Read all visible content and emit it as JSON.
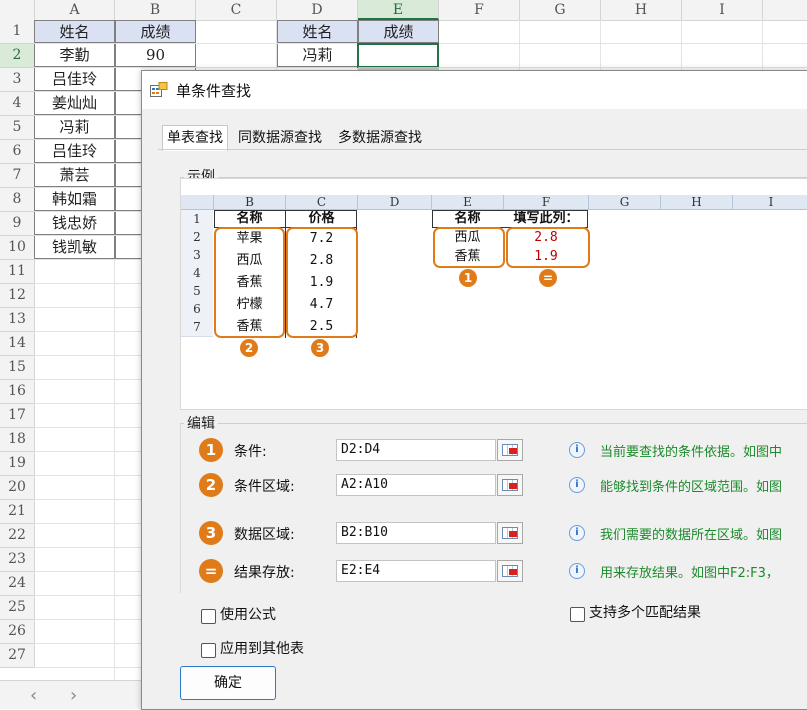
{
  "sheet": {
    "columns": [
      "A",
      "B",
      "C",
      "D",
      "E",
      "F",
      "G",
      "H",
      "I"
    ],
    "rows": [
      "1",
      "2",
      "3",
      "4",
      "5",
      "6",
      "7",
      "8",
      "9",
      "10",
      "11",
      "12",
      "13",
      "14",
      "15",
      "16",
      "17",
      "18",
      "19",
      "20",
      "21",
      "22",
      "23",
      "24",
      "25",
      "26",
      "27"
    ],
    "header_name": "姓名",
    "header_score": "成绩",
    "names": [
      "李勤",
      "吕佳玲",
      "姜灿灿",
      "冯莉",
      "吕佳玲",
      "萧芸",
      "韩如霜",
      "钱忠娇",
      "钱凯敏"
    ],
    "first_score": "90",
    "lookup_header_name": "姓名",
    "lookup_header_score": "成绩",
    "lookup_name": "冯莉"
  },
  "dialog": {
    "title": "单条件查找",
    "tabs": [
      "单表查找",
      "同数据源查找",
      "多数据源查找"
    ],
    "example_label": "示例",
    "example": {
      "columns": [
        "B",
        "C",
        "D",
        "E",
        "F",
        "G",
        "H",
        "I"
      ],
      "rows": [
        "1",
        "2",
        "3",
        "4",
        "5",
        "6",
        "7"
      ],
      "hdr_name": "名称",
      "hdr_price": "价格",
      "items": [
        "苹果",
        "西瓜",
        "香蕉",
        "柠檬",
        "香蕉"
      ],
      "prices": [
        "7.2",
        "2.8",
        "1.9",
        "4.7",
        "2.5"
      ],
      "lookup_hdr_name": "名称",
      "lookup_hdr_fill": "填写此列：",
      "lookup_items": [
        "西瓜",
        "香蕉"
      ],
      "lookup_results": [
        "2.8",
        "1.9"
      ],
      "badge1": "1",
      "badge2": "2",
      "badge3": "3",
      "badge_eq": "="
    },
    "edit_label": "编辑",
    "fields": [
      {
        "badge": "1",
        "label": "条件:",
        "value": "D2:D4",
        "hint": "当前要查找的条件依据。如图中"
      },
      {
        "badge": "2",
        "label": "条件区域:",
        "value": "A2:A10",
        "hint": "能够找到条件的区域范围。如图"
      },
      {
        "badge": "3",
        "label": "数据区域:",
        "value": "B2:B10",
        "hint": "我们需要的数据所在区域。如图"
      },
      {
        "badge": "=",
        "label": "结果存放:",
        "value": "E2:E4",
        "hint": "用来存放结果。如图中F2:F3，"
      }
    ],
    "use_formula_label": "使用公式",
    "apply_other_label": "应用到其他表",
    "multi_match_label": "支持多个匹配结果",
    "ok_label": "确定"
  },
  "colors": {
    "accent_orange": "#e07b1a",
    "hint_green": "#1c8a2a",
    "excel_green": "#217346"
  }
}
